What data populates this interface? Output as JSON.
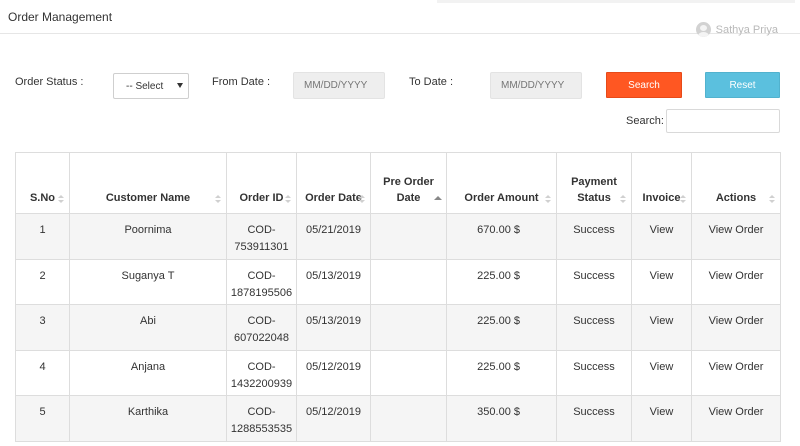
{
  "header": {
    "title": "Order Management",
    "user_name": "Sathya Priya"
  },
  "filters": {
    "status_label": "Order Status :",
    "status_selected": "-- Select",
    "from_label": "From Date :",
    "from_placeholder": "MM/DD/YYYY",
    "to_label": "To Date :",
    "to_placeholder": "MM/DD/YYYY",
    "search_button": "Search",
    "reset_button": "Reset"
  },
  "table_search": {
    "label": "Search:",
    "value": ""
  },
  "table": {
    "headers": {
      "sno": "S.No",
      "customer": "Customer Name",
      "order_id": "Order ID",
      "order_date": "Order Date",
      "pre_order_date": "Pre Order Date",
      "amount": "Order Amount",
      "payment_status": "Payment Status",
      "invoice": "Invoice",
      "actions": "Actions"
    },
    "rows": [
      {
        "sno": "1",
        "customer": "Poornima",
        "order_id": "COD-753911301",
        "order_date": "05/21/2019",
        "pre_order_date": "",
        "amount": "670.00 $",
        "payment_status": "Success",
        "invoice": "View",
        "action": "View Order"
      },
      {
        "sno": "2",
        "customer": "Suganya T",
        "order_id": "COD-1878195506",
        "order_date": "05/13/2019",
        "pre_order_date": "",
        "amount": "225.00 $",
        "payment_status": "Success",
        "invoice": "View",
        "action": "View Order"
      },
      {
        "sno": "3",
        "customer": "Abi",
        "order_id": "COD-607022048",
        "order_date": "05/13/2019",
        "pre_order_date": "",
        "amount": "225.00 $",
        "payment_status": "Success",
        "invoice": "View",
        "action": "View Order"
      },
      {
        "sno": "4",
        "customer": "Anjana",
        "order_id": "COD-1432200939",
        "order_date": "05/12/2019",
        "pre_order_date": "",
        "amount": "225.00 $",
        "payment_status": "Success",
        "invoice": "View",
        "action": "View Order"
      },
      {
        "sno": "5",
        "customer": "Karthika",
        "order_id": "COD-1288553535",
        "order_date": "05/12/2019",
        "pre_order_date": "",
        "amount": "350.00 $",
        "payment_status": "Success",
        "invoice": "View",
        "action": "View Order"
      }
    ]
  },
  "colors": {
    "search_button": "#ff5722",
    "reset_button": "#5bc0de",
    "row_stripe": "#f5f5f5",
    "border": "#dddddd"
  }
}
